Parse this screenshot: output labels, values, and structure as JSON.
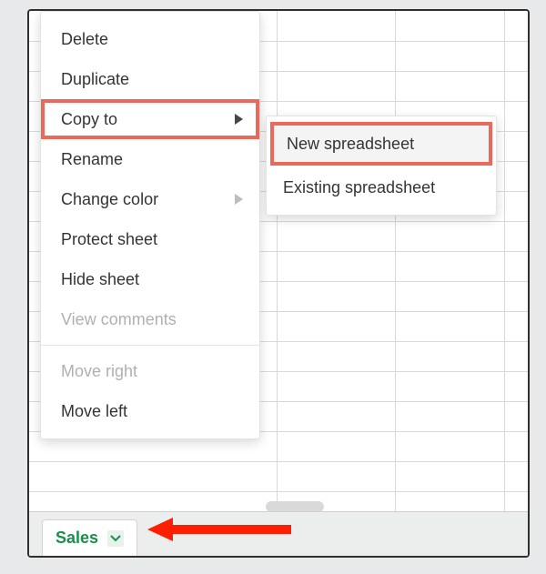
{
  "context_menu": {
    "items": [
      {
        "label": "Delete",
        "disabled": false,
        "submenu": false
      },
      {
        "label": "Duplicate",
        "disabled": false,
        "submenu": false
      },
      {
        "label": "Copy to",
        "disabled": false,
        "submenu": true,
        "highlighted": true
      },
      {
        "label": "Rename",
        "disabled": false,
        "submenu": false
      },
      {
        "label": "Change color",
        "disabled": false,
        "submenu": true
      },
      {
        "label": "Protect sheet",
        "disabled": false,
        "submenu": false
      },
      {
        "label": "Hide sheet",
        "disabled": false,
        "submenu": false
      },
      {
        "label": "View comments",
        "disabled": true,
        "submenu": false
      },
      {
        "label": "Move right",
        "disabled": true,
        "submenu": false
      },
      {
        "label": "Move left",
        "disabled": false,
        "submenu": false
      }
    ]
  },
  "submenu": {
    "items": [
      {
        "label": "New spreadsheet",
        "highlighted": true
      },
      {
        "label": "Existing spreadsheet",
        "highlighted": false
      }
    ]
  },
  "sheet_tab": {
    "name": "Sales"
  }
}
